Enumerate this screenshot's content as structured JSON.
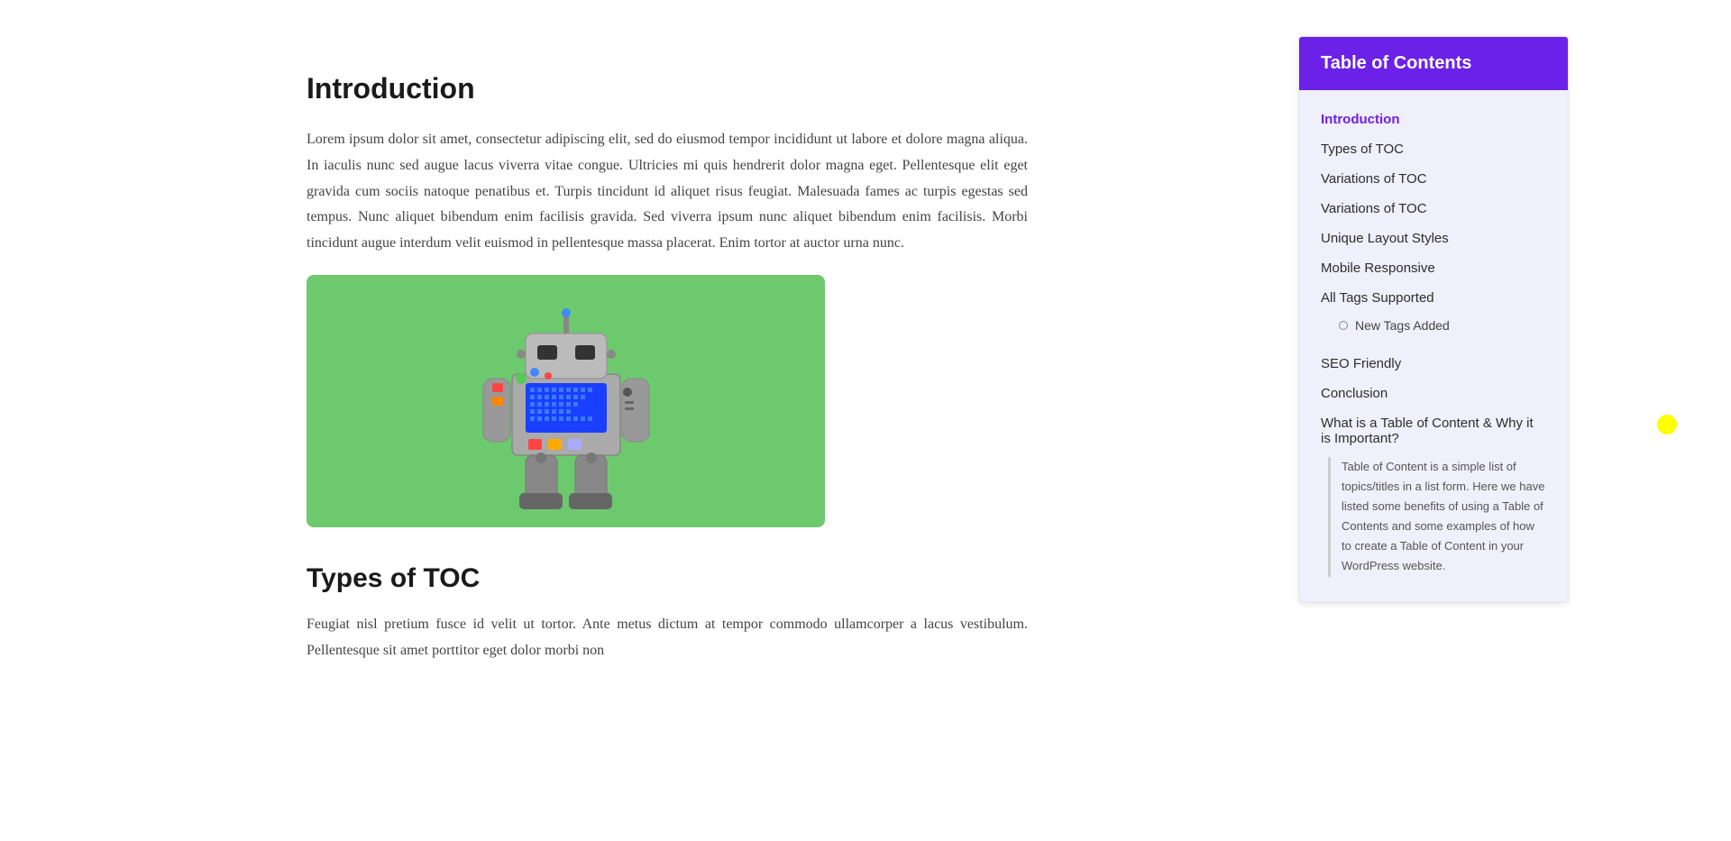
{
  "toc": {
    "header": "Table of Contents",
    "items": [
      {
        "label": "Introduction",
        "active": true,
        "id": "toc-introduction"
      },
      {
        "label": "Types of TOC",
        "active": false,
        "id": "toc-types"
      },
      {
        "label": "Variations of TOC",
        "active": false,
        "id": "toc-variations-1"
      },
      {
        "label": "Variations of TOC",
        "active": false,
        "id": "toc-variations-2"
      },
      {
        "label": "Unique Layout Styles",
        "active": false,
        "id": "toc-unique"
      },
      {
        "label": "Mobile Responsive",
        "active": false,
        "id": "toc-mobile"
      },
      {
        "label": "All Tags Supported",
        "active": false,
        "id": "toc-tags",
        "sub": [
          {
            "label": "New Tags Added"
          }
        ]
      },
      {
        "label": "SEO Friendly",
        "active": false,
        "id": "toc-seo"
      },
      {
        "label": "Conclusion",
        "active": false,
        "id": "toc-conclusion"
      },
      {
        "label": "What is a Table of Content & Why it is Important?",
        "active": false,
        "id": "toc-what",
        "nested_text": "Table of Content is a simple list of topics/titles in a list form. Here we have listed some benefits of using a Table of Contents and some examples of how to create a Table of Content in your WordPress website."
      }
    ]
  },
  "article": {
    "intro_heading": "Introduction",
    "intro_body": "Lorem ipsum dolor sit amet, consectetur adipiscing elit, sed do eiusmod tempor incididunt ut labore et dolore magna aliqua. In iaculis nunc sed augue lacus viverra vitae congue. Ultricies mi quis hendrerit dolor magna eget. Pellentesque elit eget gravida cum sociis natoque penatibus et. Turpis tincidunt id aliquet risus feugiat. Malesuada fames ac turpis egestas sed tempus. Nunc aliquet bibendum enim facilisis gravida. Sed viverra ipsum nunc aliquet bibendum enim facilisis. Morbi tincidunt augue interdum velit euismod in pellentesque massa placerat. Enim tortor at auctor urna nunc.",
    "types_heading": "Types of TOC",
    "types_body": "Feugiat nisl pretium fusce id velit ut tortor. Ante metus dictum at tempor commodo ullamcorper a lacus vestibulum. Pellentesque sit amet porttitor eget dolor morbi non"
  }
}
